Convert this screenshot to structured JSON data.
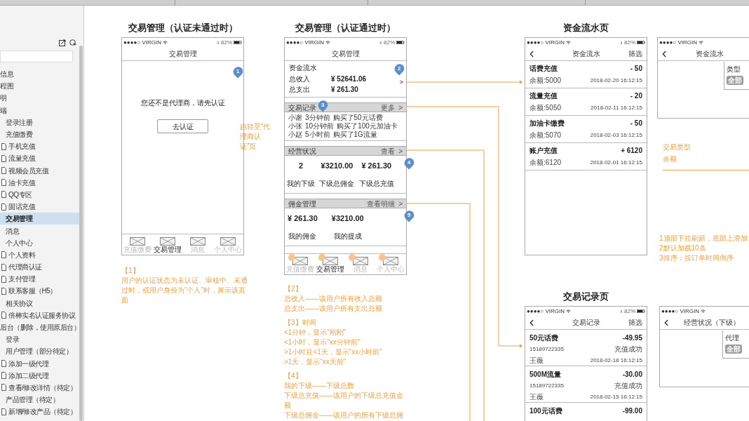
{
  "sidebar": {
    "items": [
      {
        "label": "信息",
        "doc_icon": false,
        "selected": false
      },
      {
        "label": "程图",
        "doc_icon": false,
        "selected": false
      },
      {
        "label": "明",
        "doc_icon": false,
        "selected": false
      },
      {
        "label": "端",
        "doc_icon": false,
        "selected": false,
        "children": [
          {
            "label": "登录注册",
            "doc_icon": false,
            "selected": false
          },
          {
            "label": "充值缴费",
            "doc_icon": false,
            "selected": false,
            "children": [
              {
                "label": "手机充值",
                "doc_icon": true,
                "selected": false
              },
              {
                "label": "流量充值",
                "doc_icon": true,
                "selected": false
              },
              {
                "label": "视频会员充值",
                "doc_icon": true,
                "selected": false
              },
              {
                "label": "油卡充值",
                "doc_icon": true,
                "selected": false
              },
              {
                "label": "QQ专区",
                "doc_icon": true,
                "selected": false
              },
              {
                "label": "固话充值",
                "doc_icon": true,
                "selected": false
              }
            ]
          },
          {
            "label": "交易管理",
            "doc_icon": false,
            "selected": true
          },
          {
            "label": "消息",
            "doc_icon": false,
            "selected": false
          },
          {
            "label": "个人中心",
            "doc_icon": false,
            "selected": false,
            "children": [
              {
                "label": "个人资料",
                "doc_icon": true,
                "selected": false
              },
              {
                "label": "代理商认证",
                "doc_icon": true,
                "selected": false
              },
              {
                "label": "支付管理",
                "doc_icon": true,
                "selected": false
              },
              {
                "label": "联系客服（H5）",
                "doc_icon": true,
                "selected": false
              }
            ]
          },
          {
            "label": "相关协议",
            "doc_icon": false,
            "selected": false,
            "children": [
              {
                "label": "倍棒实名认证服务协议",
                "doc_icon": true,
                "selected": false
              }
            ]
          }
        ]
      },
      {
        "label": "后台（删除，使用原后台）",
        "doc_icon": false,
        "selected": false,
        "children": [
          {
            "label": "登录",
            "doc_icon": false,
            "selected": false
          },
          {
            "label": "用户管理（部分待定）",
            "doc_icon": false,
            "selected": false,
            "children": [
              {
                "label": "添加一级代理",
                "doc_icon": true,
                "selected": false
              },
              {
                "label": "添加二级代理",
                "doc_icon": true,
                "selected": false
              },
              {
                "label": "查看/修改详情（待定）",
                "doc_icon": true,
                "selected": false
              }
            ]
          },
          {
            "label": "产品管理（待定）",
            "doc_icon": false,
            "selected": false,
            "children": [
              {
                "label": "新增/修改产品（待定）",
                "doc_icon": true,
                "selected": false
              }
            ]
          }
        ]
      }
    ]
  },
  "unverified_screen": {
    "title": "交易管理（认证未通过时）",
    "status_bar": {
      "carrier": "●●●●○ VIRGIN",
      "battery": "82%"
    },
    "nav_title": "交易管理",
    "marker": "1",
    "message": "您还不是代理商，请先认证",
    "button": "去认证",
    "jump_note": "跳转至“代理商认证”页",
    "tabs": [
      {
        "label": "充值缴费",
        "selected": false
      },
      {
        "label": "交易管理",
        "selected": true
      },
      {
        "label": "消息",
        "selected": false
      },
      {
        "label": "个人中心",
        "selected": false
      }
    ],
    "tab_hotspots": false,
    "annotation": {
      "heading": "【1】",
      "text": "用户的认证状态为未认证、审核中、未通过时，或用户身份为“个人”时，展示该页面"
    }
  },
  "verified_screen": {
    "title": "交易管理（认证通过时）",
    "status_bar": {
      "carrier": "●●●●○ VIRGIN",
      "battery": "82%"
    },
    "nav_title": "交易管理",
    "funds": {
      "title": "资金流水",
      "marker": "2",
      "chevron": ">",
      "rows": [
        {
          "label": "总收入",
          "value": "¥ 52641.06"
        },
        {
          "label": "总支出",
          "value": "¥ 261.30"
        }
      ]
    },
    "records": {
      "title": "交易记录",
      "link": "更多  >",
      "marker": "3",
      "items": [
        {
          "name": "小谢",
          "time": "3分钟前",
          "action": "购买了50元话费"
        },
        {
          "name": "小张",
          "time": "10分钟前",
          "action": "购买了100元加油卡"
        },
        {
          "name": "小赵",
          "time": "5小时前",
          "action": "购买了1G流量"
        }
      ]
    },
    "business": {
      "title": "经营状况",
      "link": "查看  >",
      "marker": "4",
      "stats": [
        {
          "value": "2",
          "label": "我的下级"
        },
        {
          "value": "¥3210.00",
          "label": "下级总佣金"
        },
        {
          "value": "¥ 261.30",
          "label": "下级总充值"
        }
      ]
    },
    "commission": {
      "title": "佣金管理",
      "link": "查看明细  >",
      "marker": "5",
      "stats": [
        {
          "value": "¥ 261.30",
          "label": "我的佣金"
        },
        {
          "value": "¥3210.00",
          "label": "我的提成"
        }
      ]
    },
    "tabs": [
      {
        "label": "充值缴费",
        "selected": false
      },
      {
        "label": "交易管理",
        "selected": true
      },
      {
        "label": "消息",
        "selected": false
      },
      {
        "label": "个人中心",
        "selected": false
      }
    ],
    "tab_hotspots": true,
    "annotations": [
      {
        "heading": "【2】",
        "lines": [
          "总收入——该用户所有收入总额",
          "总支出——该用户所有支出总额"
        ]
      },
      {
        "heading": "【3】时间",
        "lines": [
          "<1分钟，显示“刚刚”",
          "<1小时，显示“xx分钟前”",
          ">1小时且<1天，显示“xx小时前”",
          ">1天，显示“xx天前”"
        ]
      },
      {
        "heading": "【4】",
        "lines": [
          "我的下级——下级总数",
          "下级总充值——该用户的下级总充值金额",
          "下级总佣金——该用户的所有下级总佣"
        ]
      }
    ]
  },
  "funds_screen": {
    "title": "资金流水页",
    "status_bar": {
      "carrier": "●●●●○ VIRGIN",
      "battery": "82%"
    },
    "nav_title": "资金流水",
    "nav_action": "筛选",
    "items": [
      {
        "title": "话费充值",
        "amount": "- 50",
        "balance": "余额:5000",
        "time": "2018-02-20 16:12:15"
      },
      {
        "title": "流量充值",
        "amount": "- 20",
        "balance": "余额:5050",
        "time": "2018-02-11 16:12:15"
      },
      {
        "title": "加油卡缴费",
        "amount": "- 50",
        "balance": "余额:5070",
        "time": "2018-02-03 16:12:15"
      },
      {
        "title": "账户充值",
        "amount": "+ 6120",
        "balance": "余额:6120",
        "time": "2018-02-01 16:12:15"
      }
    ]
  },
  "funds_filter_screen": {
    "status_bar": {
      "carrier": "●●●●○ VIRGIN"
    },
    "nav_title": "资金流水",
    "filter_label": "类型",
    "filter_chip": "全部",
    "notes": {
      "title": "交易类型",
      "subtitle": "余额"
    },
    "rules": [
      "1顶部下拉刷新，底部上滑加",
      "2默认加载10条",
      "3排序：按订单时间倒序"
    ]
  },
  "records_screen": {
    "title": "交易记录页",
    "status_bar": {
      "carrier": "●●●●○ VIRGIN",
      "battery": "82%"
    },
    "nav_title": "交易记录",
    "nav_action": "筛选",
    "items": [
      {
        "title": "50元话费",
        "amount": "-49.95",
        "phone": "15189722335",
        "status": "充值成功",
        "name": "王薇",
        "time": "2018-02-18 16:12:15"
      },
      {
        "title": "500M流量",
        "amount": "-30.00",
        "phone": "15189722335",
        "status": "充值成功",
        "name": "王薇",
        "time": "2018-02-15 16:12:15"
      },
      {
        "title": "100元话费",
        "amount": "-99.00"
      }
    ]
  },
  "business_filter_screen": {
    "status_bar": {
      "carrier": "●●●●○ VIRGIN"
    },
    "nav_title": "经营状况（下级）",
    "filter_label": "代理",
    "filter_chip": "全部"
  }
}
